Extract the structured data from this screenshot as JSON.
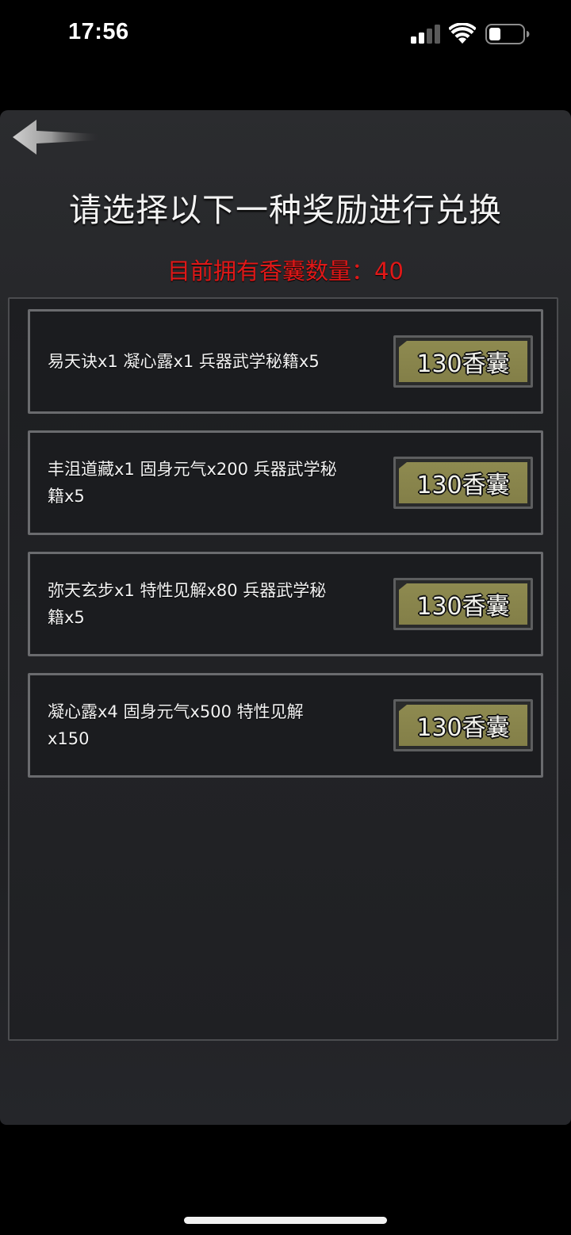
{
  "status_bar": {
    "time": "17:56"
  },
  "header": {
    "back_icon": "left-arrow-icon",
    "title": "请选择以下一种奖励进行兑换",
    "count_line": "目前拥有香囊数量：40"
  },
  "colors": {
    "count_text": "#e01818",
    "button_fill": "#8e8a50",
    "card_border": "#6a6b6e"
  },
  "rewards": [
    {
      "line1": "易天诀x1 凝心露x1 兵器武学秘籍x5",
      "line2": "",
      "button": "130香囊"
    },
    {
      "line1": "丰沮道藏x1 固身元气x200 兵器武学秘",
      "line2": "籍x5",
      "button": "130香囊"
    },
    {
      "line1": "弥天玄步x1 特性见解x80 兵器武学秘",
      "line2": "籍x5",
      "button": "130香囊"
    },
    {
      "line1": "凝心露x4 固身元气x500 特性见解",
      "line2": "x150",
      "button": "130香囊"
    }
  ]
}
